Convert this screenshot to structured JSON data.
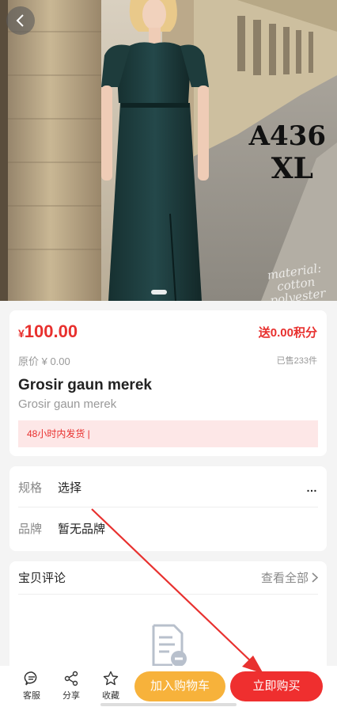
{
  "product": {
    "image_overlay": [
      "A436",
      "XL"
    ],
    "image_watermark": [
      "material:",
      "cotton",
      "polyester"
    ],
    "price_symbol": "¥",
    "price_value": "100.00",
    "points": "送0.00积分",
    "original_price": "原价 ¥ 0.00",
    "sold": "已售233件",
    "title": "Grosir gaun merek",
    "subtitle": "Grosir gaun merek",
    "shipping": "48小时内发货 |"
  },
  "specs": {
    "spec_label": "规格",
    "spec_value": "选择",
    "brand_label": "品牌",
    "brand_value": "暂无品牌",
    "more_icon": "…"
  },
  "reviews": {
    "title": "宝贝评论",
    "view_all": "查看全部",
    "empty_icon": "empty-document-icon"
  },
  "bottom_bar": {
    "service": "客服",
    "share": "分享",
    "favorite": "收藏",
    "add_to_cart": "加入购物车",
    "buy_now": "立即购买"
  },
  "colors": {
    "accent_red": "#ef2f2f",
    "cart_orange": "#f7b23b",
    "dress": "#1f3a3a"
  }
}
